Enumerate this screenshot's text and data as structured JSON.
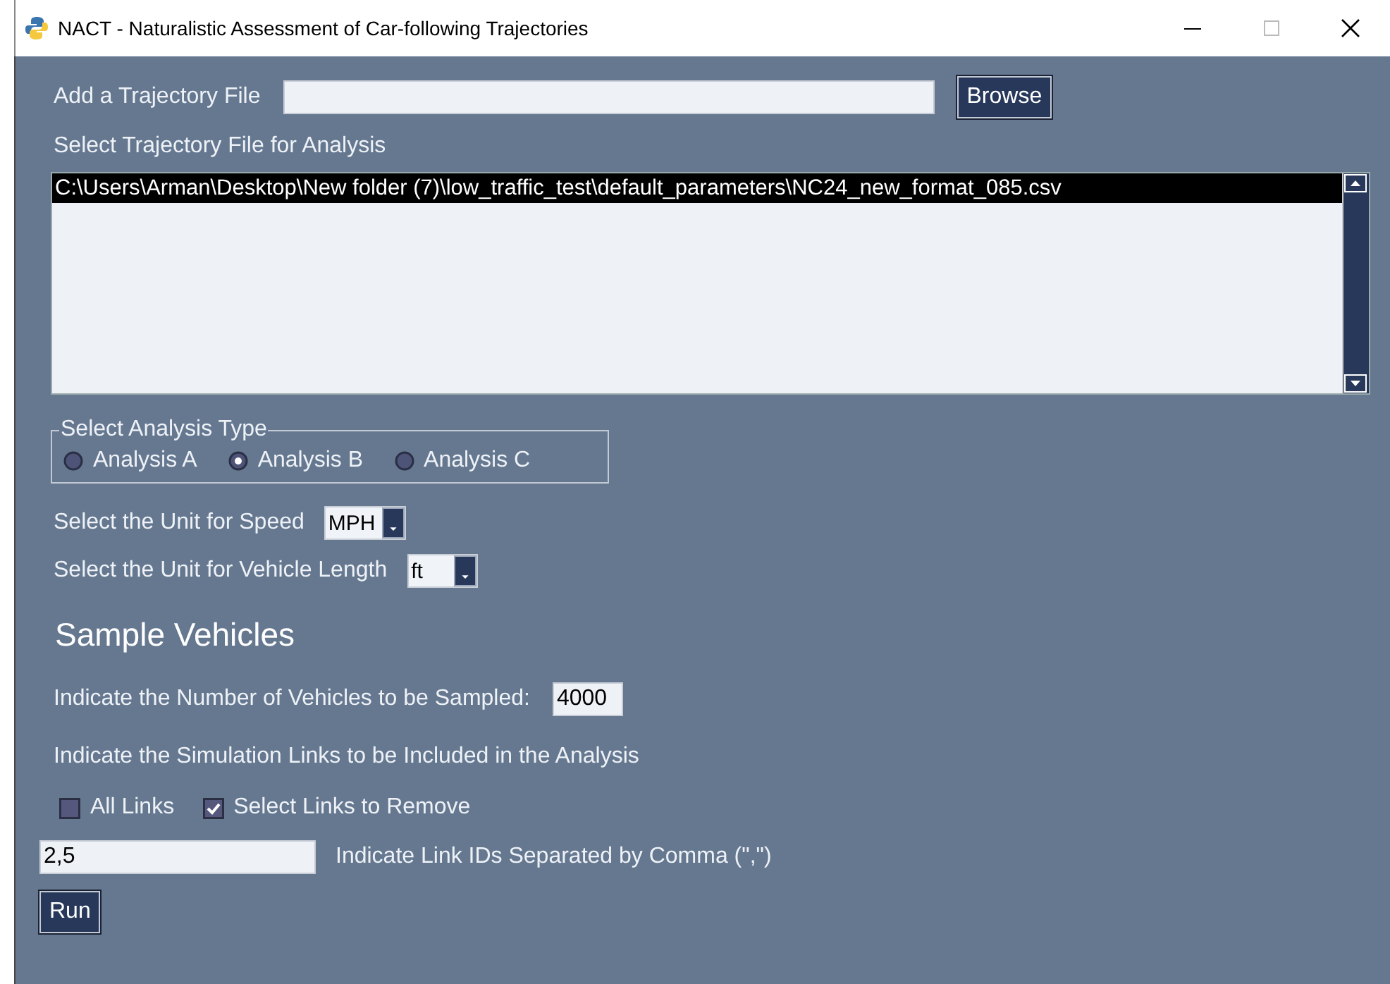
{
  "window": {
    "title": "NACT - Naturalistic Assessment of Car-following Trajectories"
  },
  "file_input": {
    "label": "Add a Trajectory File",
    "button": "Browse"
  },
  "file_list": {
    "label": "Select Trajectory File for Analysis",
    "items": [
      {
        "text": "C:\\Users\\Arman\\Desktop\\New folder (7)\\low_traffic_test\\default_parameters\\NC24_new_format_085.csv",
        "selected": true
      }
    ]
  },
  "analysis_type": {
    "legend": "Select Analysis Type",
    "options": [
      {
        "label": "Analysis A",
        "selected": false
      },
      {
        "label": "Analysis B",
        "selected": true
      },
      {
        "label": "Analysis C",
        "selected": false
      }
    ]
  },
  "speed_unit": {
    "label": "Select the Unit for Speed",
    "value": "MPH"
  },
  "length_unit": {
    "label": "Select the Unit for Vehicle Length",
    "value": "ft"
  },
  "sample": {
    "heading": "Sample Vehicles",
    "count_label": "Indicate the Number of Vehicles to be Sampled:",
    "count_value": "4000",
    "links_label": "Indicate the Simulation Links to be Included in the Analysis",
    "checkboxes": [
      {
        "label": "All Links",
        "checked": false
      },
      {
        "label": "Select Links to Remove",
        "checked": true
      }
    ],
    "link_ids": {
      "value": "2,5",
      "hint": "Indicate Link IDs Separated by Comma (\",\")"
    }
  },
  "run_button": "Run"
}
